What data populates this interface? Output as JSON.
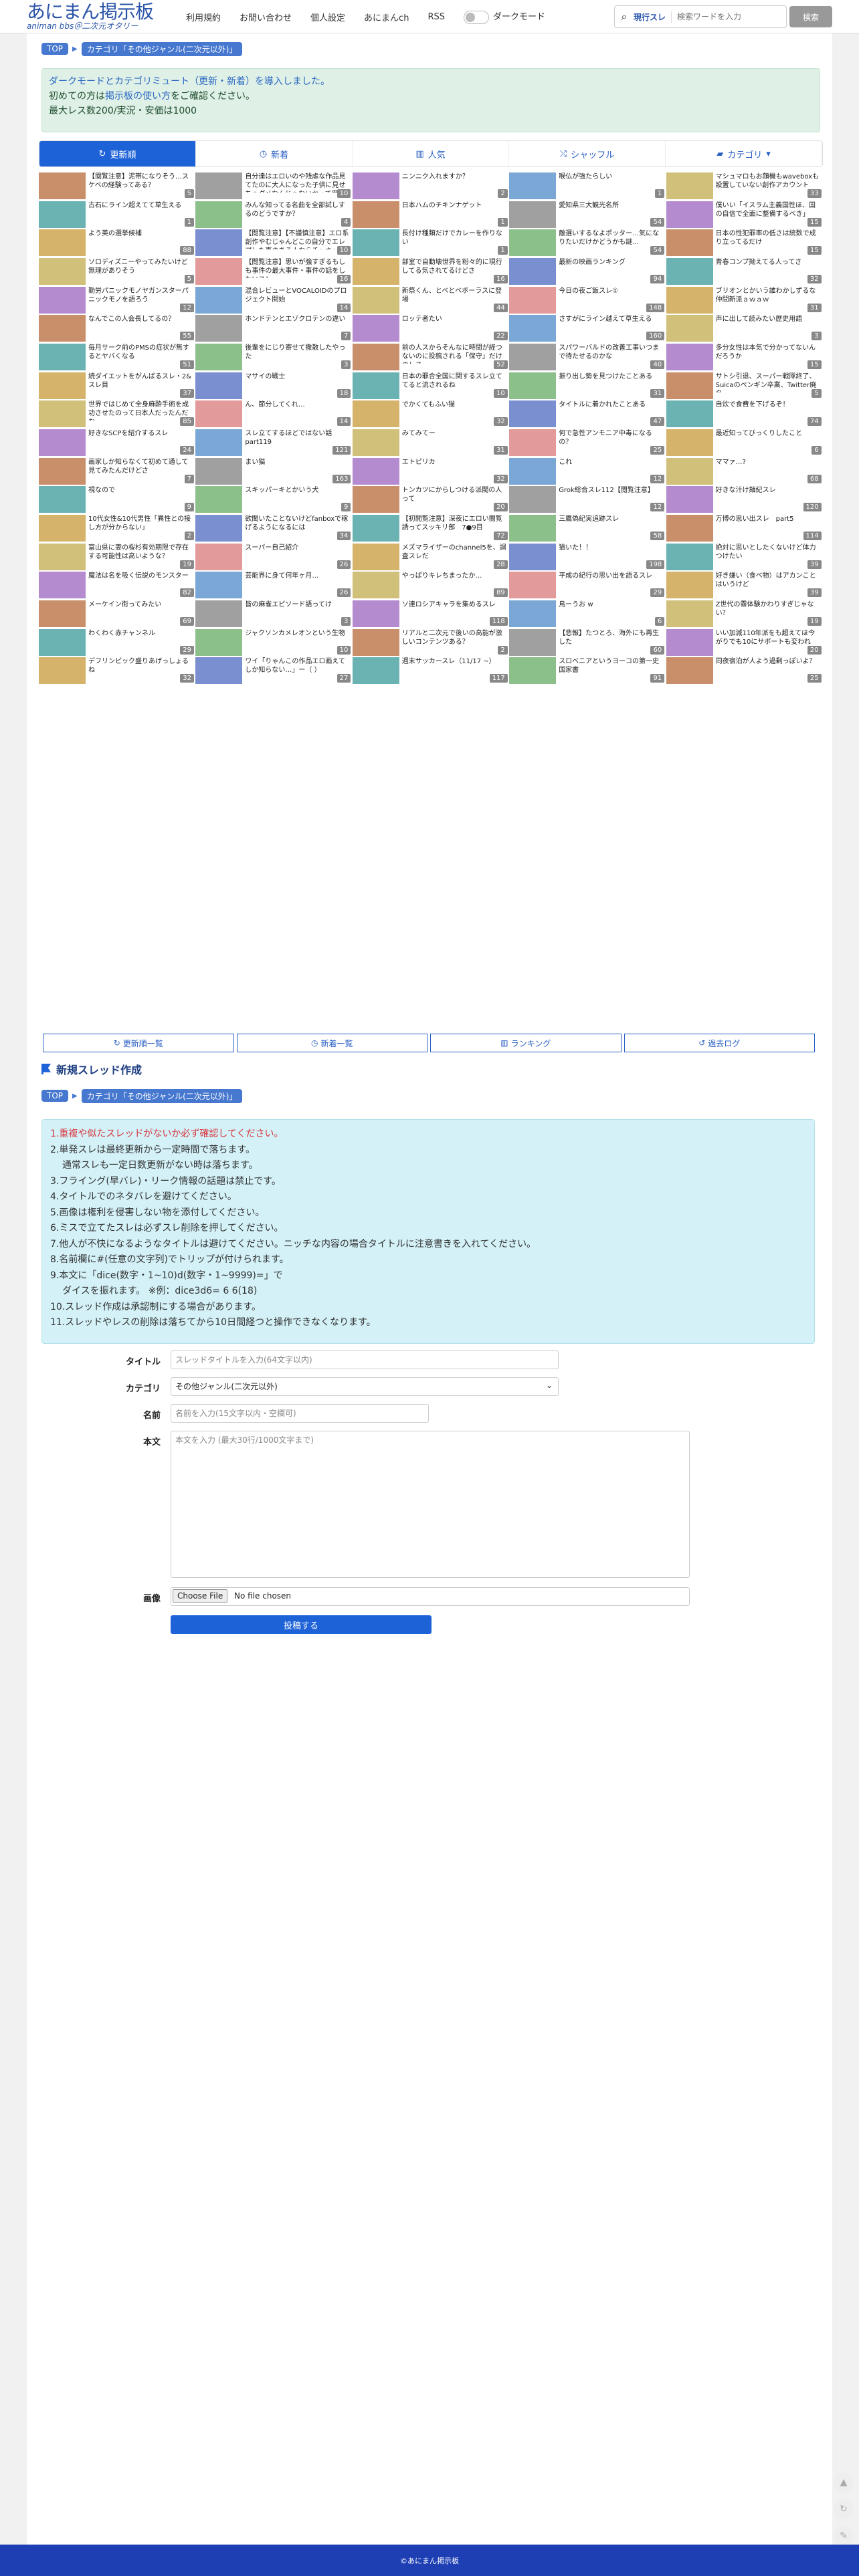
{
  "header": {
    "logo_main": "あにまん掲示板",
    "logo_sub": "animan bbs＠二次元オタリー",
    "nav": [
      "利用規約",
      "お問い合わせ",
      "個人設定",
      "あにまんch",
      "RSS"
    ],
    "dark_mode_label": "ダークモード",
    "search_scope": "現行スレ",
    "search_placeholder": "検索ワードを入力",
    "search_button": "検索"
  },
  "breadcrumb": {
    "top": "TOP",
    "category": "カテゴリ「その他ジャンル(二次元以外)」"
  },
  "notice": {
    "line1_pre": "ダークモードとカテゴリミュート（更新・新着）を導入しました。",
    "line2_pre": "初めての方は",
    "line2_link": "掲示板の使い方",
    "line2_post": "をご確認ください。",
    "line3": "最大レス数200/実況・安価は1000"
  },
  "tabs": [
    "更新順",
    "新着",
    "人気",
    "シャッフル",
    "カテゴリ"
  ],
  "threads": [
    {
      "t": "【閲覧注意】泥帯になりそう…スケベの経験ってある？",
      "c": "5"
    },
    {
      "t": "自分達はエロいのや残虐な作品見てたのに大人になった子供に見せちゃダメなんじゃないかって思うの変なことかな",
      "c": "10"
    },
    {
      "t": "ニンニク入れますか？",
      "c": "2"
    },
    {
      "t": "喉仏が強たらしい",
      "c": "1"
    },
    {
      "t": "マシュマロもお顔機もwaveboxも設置していない創作アカウント",
      "c": "33"
    },
    {
      "t": "古石にライン超えてて草生える",
      "c": "1"
    },
    {
      "t": "みんな知ってる名曲を全部試しするのどうですか？",
      "c": "4"
    },
    {
      "t": "日本ハムのチキンナゲット",
      "c": "1"
    },
    {
      "t": "愛知県三大観光名所",
      "c": "54"
    },
    {
      "t": "僕いい「イスラム主義国性ほ、国の自信で全面に整備するべき」",
      "c": "15"
    },
    {
      "t": "よう英の選挙候補",
      "c": "88"
    },
    {
      "t": "【閲覧注意】【不謹慎注意】エロ系創作やむじゃんどこの自分でエレプした事のある人ならチャキャラ",
      "c": "10"
    },
    {
      "t": "長付け種類だけでカレーを作りない",
      "c": "1"
    },
    {
      "t": "敵選いするなよポッター…気になりたいだけかどうかも謎…",
      "c": "54"
    },
    {
      "t": "日本の性犯罪率の低さは統数で成り立ってるだけ",
      "c": "15"
    },
    {
      "t": "ソロディズニーやってみたいけど無理がありそう",
      "c": "5"
    },
    {
      "t": "【閲覧注意】思いが強すぎるもしも事件の最大事件・事件の話をしたいスレ",
      "c": "16"
    },
    {
      "t": "部室で自動壊世界を粉々的に現行してる気されてるけどさ",
      "c": "16"
    },
    {
      "t": "最新の映画ランキング",
      "c": "94"
    },
    {
      "t": "青春コンプ拗えてる人ってさ",
      "c": "32"
    },
    {
      "t": "勤労パニックモノヤガンスターパニックモノを語ろう",
      "c": "12"
    },
    {
      "t": "混合レビューとVOCALOIDのプロジェクト開始",
      "c": "14"
    },
    {
      "t": "新祭くん、とべとベボーラスに登場",
      "c": "44"
    },
    {
      "t": "今日の夜ご飯スレ①",
      "c": "148"
    },
    {
      "t": "ブリオンとかいう誰わかしずるな仲間新派ａｗａｗ",
      "c": "31"
    },
    {
      "t": "なんでこの人会長してるの？",
      "c": "55"
    },
    {
      "t": "ホンドテンとエゾクロテンの違い",
      "c": "7"
    },
    {
      "t": "ロッテ者たい",
      "c": "22"
    },
    {
      "t": "さすがにライン越えて草生える",
      "c": "160"
    },
    {
      "t": "声に出して読みたい歴史用語",
      "c": "3"
    },
    {
      "t": "毎月サーク前のPMSの症状が無するとヤバくなる",
      "c": "51"
    },
    {
      "t": "後輩をにじり寄せて撒散したやった",
      "c": "3"
    },
    {
      "t": "前の人スからそんなに時間が経つないのに投稿される「保守」だけのレス",
      "c": "52"
    },
    {
      "t": "スパワーバルドの改善工事いつまで待たせるのかな",
      "c": "40"
    },
    {
      "t": "多分女性は本気で分かってないんだろうか",
      "c": "15"
    },
    {
      "t": "続ダイエットをがんばるスレ・2&スレ目",
      "c": "37"
    },
    {
      "t": "マサイの戦士",
      "c": "18"
    },
    {
      "t": "日本の罪合全国に関するスレ立ててると流されるね",
      "c": "10"
    },
    {
      "t": "振り出し勢を見つけたことある",
      "c": "31"
    },
    {
      "t": "サトシ引退、スーパー戦隊終了、Suicaのペンギン卒業、Twitter廃名…",
      "c": "5"
    },
    {
      "t": "世界ではじめて全身麻酔手術を成功させたのって日本人だったんだな",
      "c": "85"
    },
    {
      "t": "ん、節分してくれ…",
      "c": "14"
    },
    {
      "t": "でかくてもふい猫",
      "c": "32"
    },
    {
      "t": "タイトルに着かれたことある",
      "c": "47"
    },
    {
      "t": "自炊で食費を下げるぞ！",
      "c": "74"
    },
    {
      "t": "好きなSCPを紹介するスレ",
      "c": "24"
    },
    {
      "t": "スレ立てするほどではない話part119",
      "c": "121"
    },
    {
      "t": "みてみてー",
      "c": "31"
    },
    {
      "t": "何で急性アンモニア中毒になるの？",
      "c": "25"
    },
    {
      "t": "最近知ってびっくりしたこと",
      "c": "6"
    },
    {
      "t": "画家しか知らなくて初めて通して見てみたんだけどさ",
      "c": "7"
    },
    {
      "t": "まい猫",
      "c": "163"
    },
    {
      "t": "エトピリカ",
      "c": "32"
    },
    {
      "t": "これ",
      "c": "12"
    },
    {
      "t": "ママァ…?",
      "c": "68"
    },
    {
      "t": "視なので",
      "c": "9"
    },
    {
      "t": "スキッパーキとかいう犬",
      "c": "9"
    },
    {
      "t": "トンカツにからしつける派閥の人って",
      "c": "20"
    },
    {
      "t": "Grok総合スレ112【閲覧注意】",
      "c": "12"
    },
    {
      "t": "好きな汁け麺紀スレ",
      "c": "120"
    },
    {
      "t": "10代女性&10代男性「異性との接し方が分からない」",
      "c": "2"
    },
    {
      "t": "欲聞いたことないけどfanboxで稼げるようになるには",
      "c": "34"
    },
    {
      "t": "【初閲覧注意】深夜にエロい閲覧誘ってスッキリ部　7●9目",
      "c": "72"
    },
    {
      "t": "三鷹偽紀実追跡スレ",
      "c": "58"
    },
    {
      "t": "万博の思い出スレ　part5",
      "c": "114"
    },
    {
      "t": "富山県に妻の桜杉有効期限で存在する可能性は高いような？",
      "c": "19"
    },
    {
      "t": "スーパー自己紹介",
      "c": "26"
    },
    {
      "t": "メズマライザーのchannel5を、調査スレだ",
      "c": "28"
    },
    {
      "t": "猫いた！！",
      "c": "198"
    },
    {
      "t": "絶対に思いとしたくないけど体力つけたい",
      "c": "39"
    },
    {
      "t": "魔法は名を吸く伝説のモンスター",
      "c": "82"
    },
    {
      "t": "芸能界に身て何年ヶ月…",
      "c": "26"
    },
    {
      "t": "やっぱりキレちまったか…",
      "c": "89"
    },
    {
      "t": "平成の紀行の思い出を語るスレ",
      "c": "29"
    },
    {
      "t": "好き嫌い（食べ物）はアカンことはいうけど",
      "c": "39"
    },
    {
      "t": "メーケイン街ってみたい",
      "c": "69"
    },
    {
      "t": "皆の麻雀エピソード語ってけ",
      "c": "3"
    },
    {
      "t": "ソ連ロシアキャラを集めるスレ",
      "c": "118"
    },
    {
      "t": "鳥ーうお w",
      "c": "6"
    },
    {
      "t": "Z世代の霧体験かわりすぎじゃない？",
      "c": "19"
    },
    {
      "t": "わくわく赤チャンネル",
      "c": "29"
    },
    {
      "t": "ジャクソンカメレオンという生物",
      "c": "10"
    },
    {
      "t": "リアルと二次元で後いの高能が激しいコンテンツある？",
      "c": "2"
    },
    {
      "t": "【悲報】たつとろ、海外にも再生した",
      "c": "60"
    },
    {
      "t": "いい加減110年派をも超えてほ今がりでも10にサポートも変われ",
      "c": "20"
    },
    {
      "t": "デフリンピック盛りあげっしょるね",
      "c": "32"
    },
    {
      "t": "ワイ「りゃんこの作品エロ画えてしか知らない…」ー（ ）",
      "c": "27"
    },
    {
      "t": "週末サッカースレ（11/17 ~）",
      "c": "117"
    },
    {
      "t": "スロベニアというヨーコの第一史国家書",
      "c": "91"
    },
    {
      "t": "同夜宿泊が人よう過剰っぽいよ？",
      "c": "25"
    }
  ],
  "bottom_tabs": [
    "更新順一覧",
    "新着一覧",
    "ランキング",
    "過去ログ"
  ],
  "create": {
    "heading": "新規スレッド作成",
    "rules": [
      "1.重複や似たスレッドがないか必ず確認してください。",
      "2.単発スレは最終更新から一定時間で落ちます。",
      "通常スレも一定日数更新がない時は落ちます。",
      "3.フライング(早バレ)・リーク情報の話題は禁止です。",
      "4.タイトルでのネタバレを避けてください。",
      "5.画像は権利を侵害しない物を添付してください。",
      "6.ミスで立てたスレは必ずスレ削除を押してください。",
      "7.他人が不快になるようなタイトルは避けてください。ニッチな内容の場合タイトルに注意書きを入れてください。",
      "8.名前欄に#(任意の文字列)でトリップが付けられます。",
      "9.本文に「dice(数字・1~10)d(数字・1~9999)=」で",
      "ダイスを振れます。 ※例：dice3d6= 6 6(18)",
      "10.スレッド作成は承認制にする場合があります。",
      "11.スレッドやレスの削除は落ちてから10日間経つと操作できなくなります。"
    ],
    "title_label": "タイトル",
    "title_placeholder": "スレッドタイトルを入力(64文字以内)",
    "category_label": "カテゴリ",
    "category_value": "その他ジャンル(二次元以外)",
    "name_label": "名前",
    "name_placeholder": "名前を入力(15文字以内・空欄可)",
    "body_label": "本文",
    "body_placeholder": "本文を入力 (最大30行/1000文字まで)",
    "image_label": "画像",
    "file_button": "Choose File",
    "file_status": "No file chosen",
    "submit": "投稿する"
  },
  "footer": "©あにまん掲示板",
  "colors": {
    "accent": "#1e62d8",
    "footer": "#1e3fb4",
    "notice_bg": "#dff1e6",
    "rules_bg": "#d3f1f7"
  }
}
